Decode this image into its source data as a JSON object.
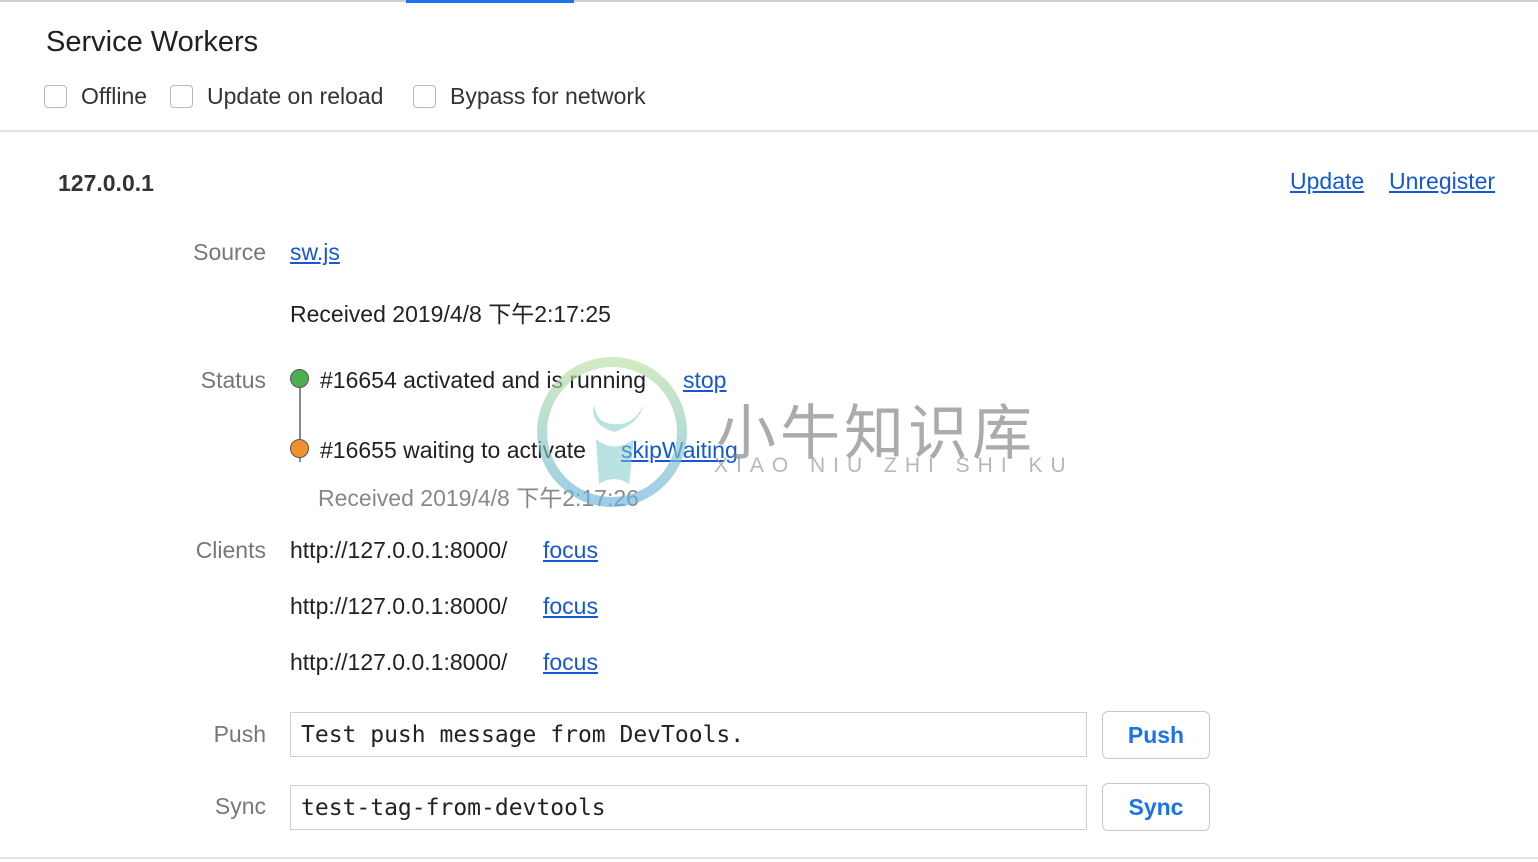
{
  "panel": {
    "title": "Service Workers",
    "options": [
      {
        "label": "Offline",
        "checked": false
      },
      {
        "label": "Update on reload",
        "checked": false
      },
      {
        "label": "Bypass for network",
        "checked": false
      }
    ]
  },
  "registration": {
    "origin": "127.0.0.1",
    "update_link": "Update",
    "unregister_link": "Unregister",
    "source_label": "Source",
    "source_file": "sw.js",
    "source_received": "Received 2019/4/8 下午2:17:25",
    "status_label": "Status",
    "statuses": [
      {
        "text": "#16654 activated and is running",
        "action": "stop",
        "color": "#4caf50"
      },
      {
        "text": "#16655 waiting to activate",
        "action": "skipWaiting",
        "color": "#f0902f",
        "received": "Received 2019/4/8 下午2:17:26"
      }
    ],
    "clients_label": "Clients",
    "clients": [
      {
        "url": "http://127.0.0.1:8000/",
        "action": "focus"
      },
      {
        "url": "http://127.0.0.1:8000/",
        "action": "focus"
      },
      {
        "url": "http://127.0.0.1:8000/",
        "action": "focus"
      }
    ],
    "push_label": "Push",
    "push_value": "Test push message from DevTools.",
    "push_button": "Push",
    "sync_label": "Sync",
    "sync_value": "test-tag-from-devtools",
    "sync_button": "Sync"
  },
  "watermark": {
    "text": "小牛知识库",
    "subtext": "XIAO NIU ZHI SHI KU"
  },
  "colors": {
    "accent": "#1a73e8",
    "link": "#1558d6"
  }
}
